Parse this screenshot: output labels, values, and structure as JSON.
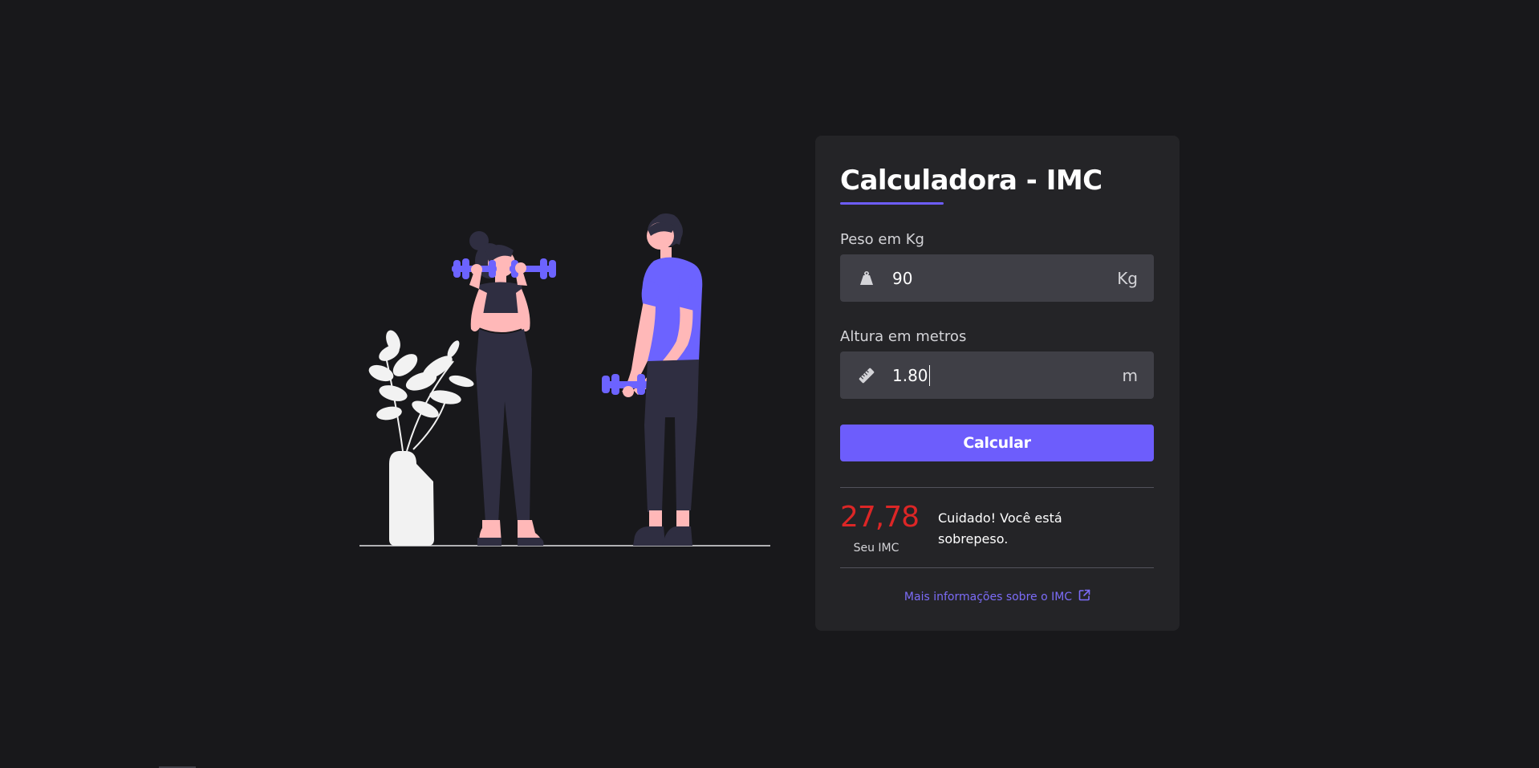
{
  "card": {
    "title": "Calculadora - IMC",
    "weight": {
      "label": "Peso em Kg",
      "value": "90",
      "unit": "Kg",
      "icon": "weight-icon"
    },
    "height": {
      "label": "Altura em metros",
      "value": "1.80",
      "unit": "m",
      "icon": "ruler-icon"
    },
    "button_label": "Calcular",
    "result": {
      "value": "27,78",
      "caption": "Seu IMC",
      "message": "Cuidado! Você está sobrepeso.",
      "value_color": "#dc2626"
    },
    "more_info_link": "Mais informações sobre o IMC",
    "link_icon": "external-link-icon"
  },
  "colors": {
    "background": "#18181b",
    "card": "#242427",
    "input": "#3f3f46",
    "accent": "#6d5dfc"
  }
}
